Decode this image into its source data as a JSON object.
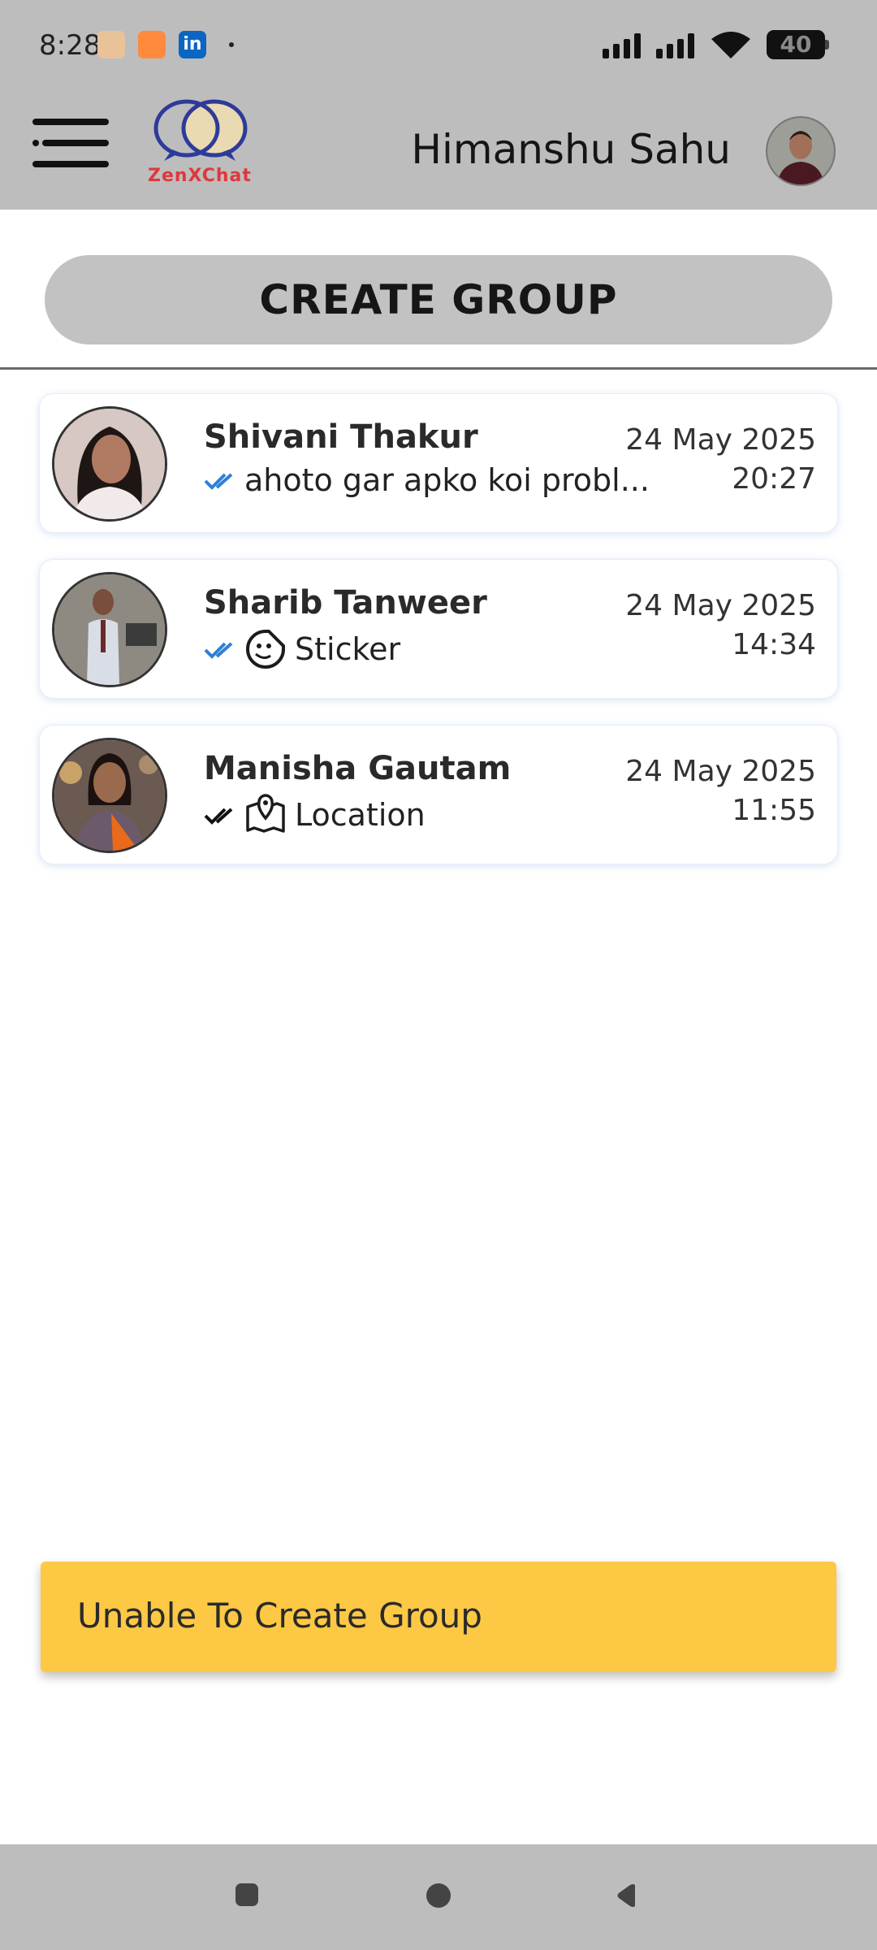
{
  "status_bar": {
    "time": "8:28",
    "battery": "40",
    "notifications": [
      "amazon-icon",
      "calendar-icon",
      "linkedin-icon"
    ]
  },
  "header": {
    "logo_text": "ZenXChat",
    "user_name": "Himanshu Sahu"
  },
  "create_group": {
    "label": "CREATE GROUP"
  },
  "chats": [
    {
      "name": "Shivani Thakur",
      "message": "ahoto gar apko koi probl...",
      "date": "24 May 2025",
      "time": "20:27",
      "type_icon": "",
      "read": true
    },
    {
      "name": "Sharib Tanweer",
      "message": "Sticker",
      "date": "24 May 2025",
      "time": "14:34",
      "type_icon": "sticker-icon",
      "read": true
    },
    {
      "name": "Manisha Gautam",
      "message": "Location",
      "date": "24 May 2025",
      "time": "11:55",
      "type_icon": "location-map-icon",
      "read": false
    }
  ],
  "snackbar": {
    "message": "Unable To Create Group",
    "color": "#fdc844"
  },
  "colors": {
    "bar_gray": "#bdbdbd",
    "read_tick": "#2f7fd8",
    "logo_red": "#e0373d",
    "logo_blue": "#2e3a9a"
  }
}
